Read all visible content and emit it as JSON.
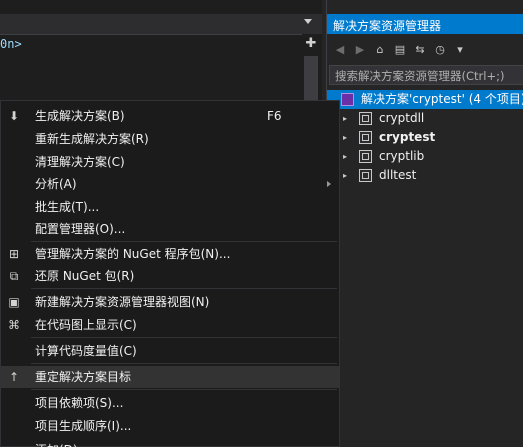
{
  "editor": {
    "code_fragment": "0n>",
    "split_icon": "split-window-icon"
  },
  "solution_explorer": {
    "title": "解决方案资源管理器",
    "toolbar_icons": [
      "back-icon",
      "forward-icon",
      "home-icon",
      "switch-views-icon",
      "sync-icon",
      "history-icon",
      "filter-icon"
    ],
    "search_placeholder": "搜索解决方案资源管理器(Ctrl+;)",
    "solution_label": "解决方案'cryptest' (4 个项目)",
    "projects": [
      {
        "label": "cryptdll",
        "bold": false
      },
      {
        "label": "cryptest",
        "bold": true
      },
      {
        "label": "cryptlib",
        "bold": false
      },
      {
        "label": "dlltest",
        "bold": false
      }
    ]
  },
  "menu": {
    "items": [
      {
        "label": "生成解决方案(B)",
        "shortcut": "F6",
        "icon": "build-icon"
      },
      {
        "label": "重新生成解决方案(R)",
        "shortcut": "",
        "icon": ""
      },
      {
        "label": "清理解决方案(C)",
        "shortcut": "",
        "icon": ""
      },
      {
        "label": "分析(A)",
        "shortcut": "",
        "icon": "",
        "submenu": true
      },
      {
        "label": "批生成(T)...",
        "shortcut": "",
        "icon": ""
      },
      {
        "label": "配置管理器(O)...",
        "shortcut": "",
        "icon": ""
      },
      {
        "label": "管理解决方案的 NuGet 程序包(N)...",
        "shortcut": "",
        "icon": "nuget-package-icon"
      },
      {
        "label": "还原 NuGet 包(R)",
        "shortcut": "",
        "icon": "restore-package-icon"
      },
      {
        "label": "新建解决方案资源管理器视图(N)",
        "shortcut": "",
        "icon": "new-view-icon"
      },
      {
        "label": "在代码图上显示(C)",
        "shortcut": "",
        "icon": "code-map-icon"
      },
      {
        "label": "计算代码度量值(C)",
        "shortcut": "",
        "icon": ""
      },
      {
        "label": "重定解决方案目标",
        "shortcut": "",
        "icon": "retarget-icon"
      },
      {
        "label": "项目依赖项(S)...",
        "shortcut": "",
        "icon": ""
      },
      {
        "label": "项目生成顺序(I)...",
        "shortcut": "",
        "icon": ""
      },
      {
        "label": "添加(D)",
        "shortcut": "",
        "icon": ""
      }
    ]
  }
}
